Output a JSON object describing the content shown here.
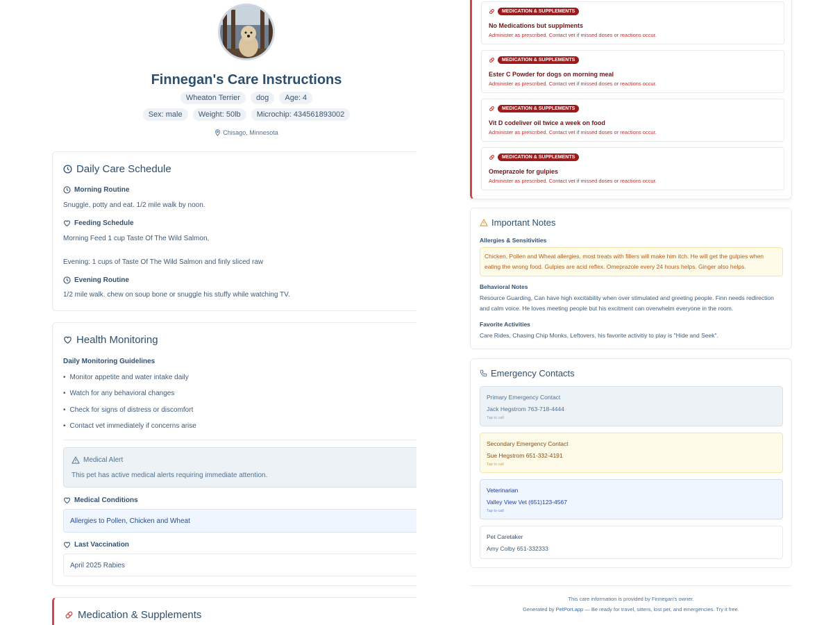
{
  "profile": {
    "name_title": "Finnegan's Care Instructions",
    "chips_row1": [
      "Wheaton Terrier",
      "dog",
      "Age: 4"
    ],
    "chips_row2": [
      "Sex: male",
      "Weight: 50lb",
      "Microchip: 434561893002"
    ],
    "location": "Chisago, Minnesota"
  },
  "daily_care": {
    "title": "Daily Care Schedule",
    "morning_label": "Morning Routine",
    "morning_text": "Snuggle, potty and eat. 1/2 mile walk by noon.",
    "feeding_label": "Feeding Schedule",
    "feeding_morning": "Morning Feed 1 cup Taste Of The Wild Salmon,",
    "feeding_evening": "Evening: 1 cups of  Taste Of The Wild Salmon and finly sliced raw",
    "evening_label": "Evening Routine",
    "evening_text": "1/2 mile walk. chew on soup bone or snuggle his stuffy while watching TV."
  },
  "health": {
    "title": "Health Monitoring",
    "guidelines_label": "Daily Monitoring Guidelines",
    "guidelines": [
      "Monitor appetite and water intake daily",
      "Watch for any behavioral changes",
      "Check for signs of distress or discomfort",
      "Contact vet immediately if concerns arise"
    ],
    "alert_title": "Medical Alert",
    "alert_text": "This pet has active medical alerts requiring immediate attention.",
    "conditions_label": "Medical Conditions",
    "conditions_value": "Allergies to Pollen, Chicken and Wheat",
    "vaccination_label": "Last Vaccination",
    "vaccination_value": "April 2025 Rabies"
  },
  "medication_section": {
    "title": "Medication & Supplements"
  },
  "medications": [
    {
      "tag": "Medication & Supplements",
      "name": "No Medications but supplments",
      "instructions": "Administer as prescribed. Contact vet if missed doses or reactions occur."
    },
    {
      "tag": "Medication & Supplements",
      "name": "Ester C Powder for dogs on morning meal",
      "instructions": "Administer as prescribed. Contact vet if missed doses or reactions occur."
    },
    {
      "tag": "Medication & Supplements",
      "name": "Vit D codeliver oil twice a week on food",
      "instructions": "Administer as prescribed. Contact vet if missed doses or reactions occur."
    },
    {
      "tag": "Medication & Supplements",
      "name": "Omeprazole for gulpies",
      "instructions": "Administer as prescribed. Contact vet if missed doses or reactions occur."
    }
  ],
  "notes": {
    "title": "Important Notes",
    "allergies_label": "Allergies & Sensitivities",
    "allergies_text": "Chicken, Pollen and Wheat allergies, most treats with fillers will make him itch. He will get the gulpies when eating the wrong food. Gulpies are acid reflex. Omeprazole every 24 hours helps. Ginger also helps.",
    "behavior_label": "Behavioral Notes",
    "behavior_text": "Resource Guarding, Can have high excitability when over stimulated and greeting people. Finn needs redirection and calm voice. He loves meeting people but his excitment can overwhelm everyone in the room.",
    "activities_label": "Favorite Activities",
    "activities_text": "Care Rides, Chasing Chip Monks, Leftovers, his favorite activitiy to play is \"Hide and Seek\"."
  },
  "contacts": {
    "title": "Emergency Contacts",
    "items": [
      {
        "label": "Primary Emergency Contact",
        "value": "Jack Hegstrom 763-718-4444",
        "tap": "Tap to call"
      },
      {
        "label": "Secondary Emergency Contact",
        "value": "Sue Hegstrom 651-332-4191",
        "tap": "Tap to call"
      },
      {
        "label": "Veterinarian",
        "value": "Valley View Vet (651)123-4567",
        "tap": "Tap to call"
      },
      {
        "label": "Pet Caretaker",
        "value": "Amy Colby 651-332333"
      }
    ]
  },
  "footer": {
    "line1": "This care information is provided by Finnegan's owner.",
    "line2_prefix": "Generated by ",
    "line2_link": "PetPort.app",
    "line2_suffix": " — Be ready for travel, sitters, lost pet, and emergencies. Try it free."
  },
  "colors": {
    "accent": "#2d4f6e",
    "alert_red": "#9b1c1c",
    "medical_alert_bg": "#edf2f7",
    "secondary_contact_bg": "#fefce8",
    "vet_contact_bg": "#eff6ff"
  }
}
